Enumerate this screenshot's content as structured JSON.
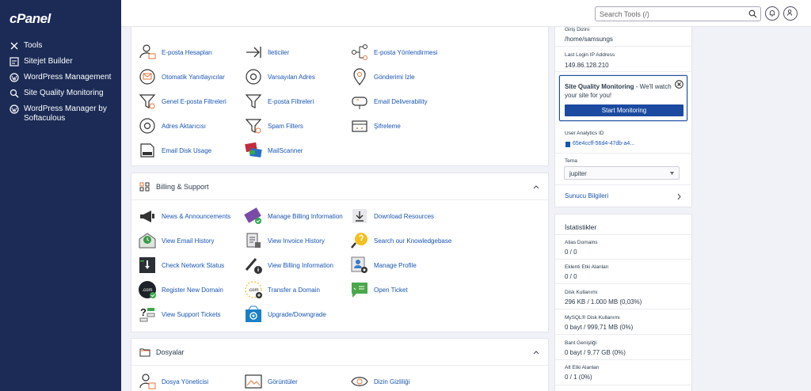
{
  "sidebar": {
    "logo": "cPanel",
    "items": [
      {
        "label": "Tools",
        "icon": "tools-icon"
      },
      {
        "label": "Sitejet Builder",
        "icon": "sitejet-icon"
      },
      {
        "label": "WordPress Management",
        "icon": "wordpress-icon"
      },
      {
        "label": "Site Quality Monitoring",
        "icon": "search-icon"
      },
      {
        "label": "WordPress Manager by Softaculous",
        "icon": "wordpress-icon"
      }
    ]
  },
  "header": {
    "search_placeholder": "Search Tools (/)"
  },
  "email_section": {
    "items": [
      "E-posta Hesapları",
      "İleticiler",
      "E-posta Yönlendirmesi",
      "Otomatik Yanıtlayıcılar",
      "Varsayılan Adres",
      "Gönderimi İzle",
      "Genel E-posta Filtreleri",
      "E-posta Filtreleri",
      "Email Deliverability",
      "Adres Aktarıcısı",
      "Spam Filters",
      "Şifreleme",
      "Email Disk Usage",
      "MailScanner"
    ]
  },
  "billing_section": {
    "title": "Billing & Support",
    "items": [
      "News & Announcements",
      "Manage Billing Information",
      "Download Resources",
      "View Email History",
      "View Invoice History",
      "Search our Knowledgebase",
      "Check Network Status",
      "View Billing Information",
      "Manage Profile",
      "Register New Domain",
      "Transfer a Domain",
      "Open Ticket",
      "View Support Tickets",
      "Upgrade/Downgrade"
    ]
  },
  "files_section": {
    "title": "Dosyalar",
    "items": [
      "Dosya Yöneticisi",
      "Görüntüler",
      "Dizin Gizliliği"
    ]
  },
  "general_info": {
    "home_dir_label": "Giriş Dizini",
    "home_dir_value": "/home/samsungs",
    "last_login_label": "Last Login IP Address",
    "last_login_value": "149.86.128.210",
    "sqm_title": "Site Quality Monitoring",
    "sqm_text": " - We'll watch your site for you!",
    "sqm_button": "Start Monitoring",
    "analytics_label": "User Analytics ID",
    "analytics_value": "65e4ccff-56d4-47db-a4...",
    "theme_label": "Tema",
    "theme_value": "jupiter",
    "server_info": "Sunucu Bilgileri"
  },
  "stats": {
    "title": "İstatistikler",
    "rows": [
      {
        "label": "Alias Domains",
        "value": "0 / 0"
      },
      {
        "label": "Eklenti Etki Alanları",
        "value": "0 / 0"
      },
      {
        "label": "Disk Kullanımı",
        "value": "296 KB / 1.000 MB   (0,03%)"
      },
      {
        "label": "MySQL® Disk Kullanımı",
        "value": "0 bayt / 999,71 MB   (0%)"
      },
      {
        "label": "Bant Genişliği",
        "value": "0 bayt / 9,77 GB   (0%)"
      },
      {
        "label": "Alt Etki Alanları",
        "value": "0 / 1   (0%)"
      }
    ]
  },
  "colors": {
    "sidebar": "#1b2b56",
    "link": "#1a55b4",
    "button": "#1b4aa0"
  }
}
